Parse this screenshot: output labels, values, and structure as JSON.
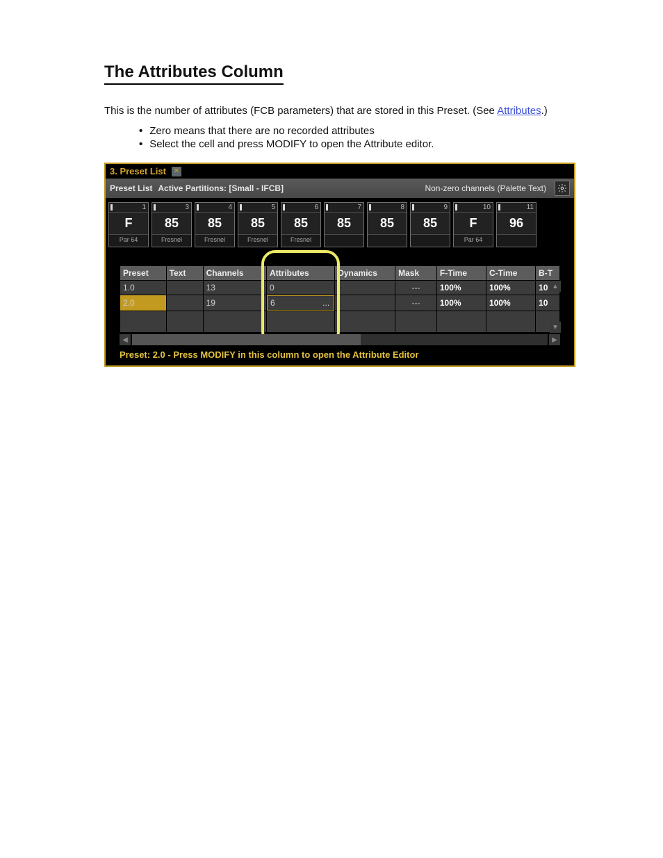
{
  "doc": {
    "heading": "The Attributes Column",
    "para_open": "This is the number of attributes (FCB parameters) that are stored in this Preset. (See ",
    "link_text": "Attributes",
    "para_close": ".)",
    "bullet1": "Zero means that there are no recorded attributes",
    "bullet2": "Select the cell and press MODIFY to open the Attribute editor."
  },
  "panel": {
    "tab_title": "3. Preset List",
    "subheader_left_a": "Preset List",
    "subheader_left_b": "Active Partitions: [Small - IFCB]",
    "subheader_right": "Non-zero channels (Palette Text)",
    "status": "Preset: 2.0 - Press MODIFY in this column to open the Attribute Editor"
  },
  "tiles": [
    {
      "num": "1",
      "val": "F",
      "lbl": "Par 64"
    },
    {
      "num": "3",
      "val": "85",
      "lbl": "Fresnel"
    },
    {
      "num": "4",
      "val": "85",
      "lbl": "Fresnel"
    },
    {
      "num": "5",
      "val": "85",
      "lbl": "Fresnel"
    },
    {
      "num": "6",
      "val": "85",
      "lbl": "Fresnel"
    },
    {
      "num": "7",
      "val": "85",
      "lbl": ""
    },
    {
      "num": "8",
      "val": "85",
      "lbl": ""
    },
    {
      "num": "9",
      "val": "85",
      "lbl": ""
    },
    {
      "num": "10",
      "val": "F",
      "lbl": "Par 64"
    },
    {
      "num": "11",
      "val": "96",
      "lbl": ""
    }
  ],
  "table": {
    "headers": [
      "Preset",
      "Text",
      "Channels",
      "Attributes",
      "Dynamics",
      "Mask",
      "F-Time",
      "C-Time",
      "B-T"
    ],
    "rows": [
      {
        "sel": false,
        "preset": "1.0",
        "text": "",
        "channels": "13",
        "attributes": "0",
        "attr_dots": "",
        "dynamics": "",
        "mask": "---",
        "ftime": "100%",
        "ctime": "100%",
        "bt": "10"
      },
      {
        "sel": true,
        "preset": "2.0",
        "text": "",
        "channels": "19",
        "attributes": "6",
        "attr_dots": "...",
        "dynamics": "",
        "mask": "---",
        "ftime": "100%",
        "ctime": "100%",
        "bt": "10"
      }
    ]
  }
}
